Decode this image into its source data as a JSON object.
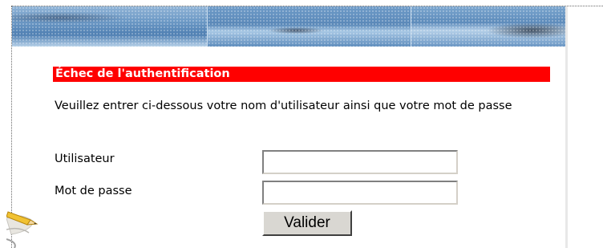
{
  "error": {
    "title": "Échec de l'authentification",
    "bar_color": "#ff0000",
    "text_color": "#ffffff"
  },
  "instruction": "Veuillez entrer ci-dessous votre nom d'utilisateur ainsi que votre mot de passe",
  "form": {
    "username_label": "Utilisateur",
    "username_value": "",
    "password_label": "Mot de passe",
    "password_value": "",
    "submit_label": "Valider"
  },
  "decorations": {
    "banner": "harbor-photo-banner",
    "corner_icon": "pencil-icon"
  }
}
